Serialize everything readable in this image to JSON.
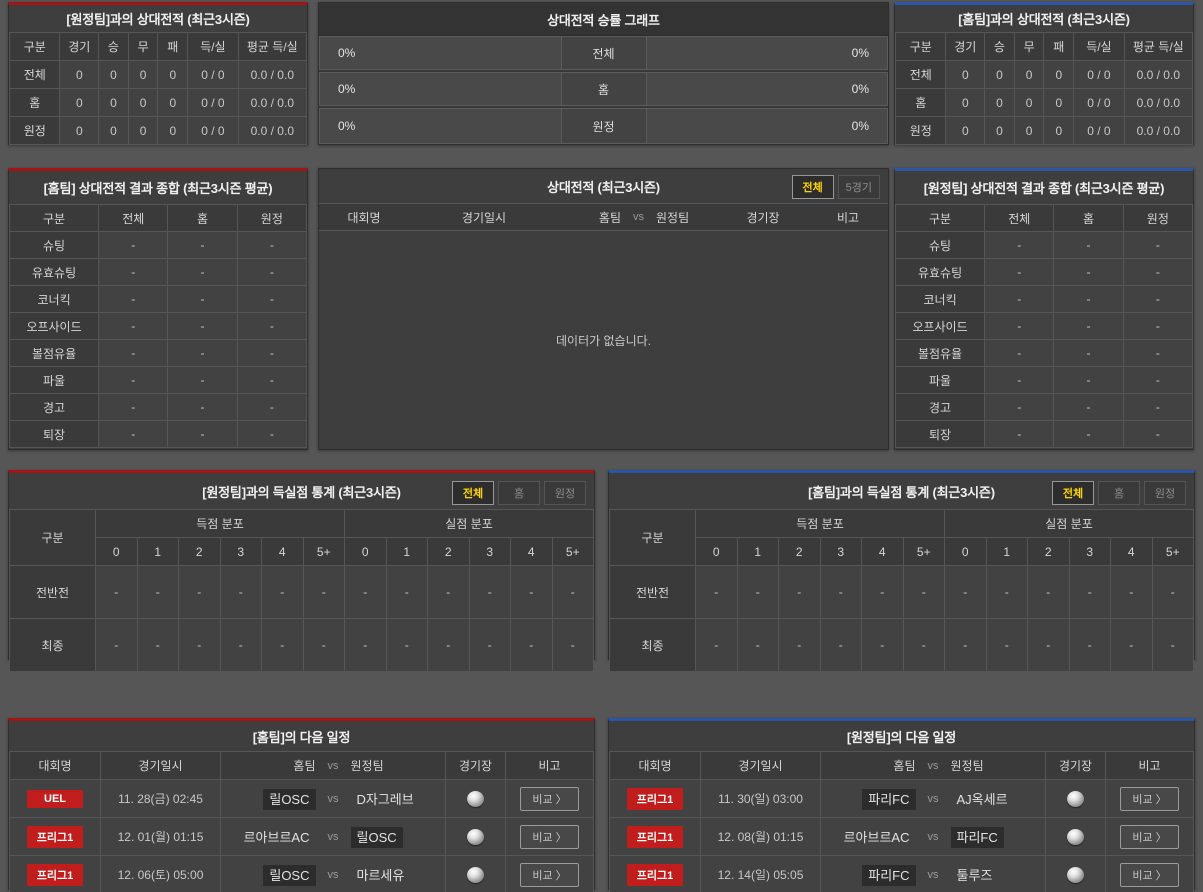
{
  "colors": {
    "accent_red": "#a31515",
    "accent_blue": "#2d55a5",
    "tab_active_text": "#ffd400",
    "league_badge": "#c21d1d"
  },
  "labels": {
    "vs": "vs",
    "compare": "비교 〉",
    "team_header_home": "홈팀",
    "team_header_away": "원정팀",
    "col_league": "대회명",
    "col_datetime": "경기일시",
    "col_stadium": "경기장",
    "col_note": "비고"
  },
  "top_away": {
    "title": "[원정팀]과의 상대전적 (최근3시즌)",
    "headers": [
      "구분",
      "경기",
      "승",
      "무",
      "패",
      "득/실",
      "평균 득/실"
    ],
    "rows": [
      {
        "label": "전체",
        "values": [
          "0",
          "0",
          "0",
          "0",
          "0 / 0",
          "0.0 / 0.0"
        ]
      },
      {
        "label": "홈",
        "values": [
          "0",
          "0",
          "0",
          "0",
          "0 / 0",
          "0.0 / 0.0"
        ]
      },
      {
        "label": "원정",
        "values": [
          "0",
          "0",
          "0",
          "0",
          "0 / 0",
          "0.0 / 0.0"
        ]
      }
    ]
  },
  "winrate": {
    "title": "상대전적 승률 그래프",
    "rows": [
      {
        "left": "0%",
        "label": "전체",
        "right": "0%"
      },
      {
        "left": "0%",
        "label": "홈",
        "right": "0%"
      },
      {
        "left": "0%",
        "label": "원정",
        "right": "0%"
      }
    ]
  },
  "top_home": {
    "title": "[홈팀]과의 상대전적 (최근3시즌)",
    "headers": [
      "구분",
      "경기",
      "승",
      "무",
      "패",
      "득/실",
      "평균 득/실"
    ],
    "rows": [
      {
        "label": "전체",
        "values": [
          "0",
          "0",
          "0",
          "0",
          "0 / 0",
          "0.0 / 0.0"
        ]
      },
      {
        "label": "홈",
        "values": [
          "0",
          "0",
          "0",
          "0",
          "0 / 0",
          "0.0 / 0.0"
        ]
      },
      {
        "label": "원정",
        "values": [
          "0",
          "0",
          "0",
          "0",
          "0 / 0",
          "0.0 / 0.0"
        ]
      }
    ]
  },
  "summary_home": {
    "title": "[홈팀] 상대전적 결과 종합 (최근3시즌 평균)",
    "headers": [
      "구분",
      "전체",
      "홈",
      "원정"
    ],
    "rows": [
      {
        "label": "슈팅",
        "values": [
          "-",
          "-",
          "-"
        ]
      },
      {
        "label": "유효슈팅",
        "values": [
          "-",
          "-",
          "-"
        ]
      },
      {
        "label": "코너킥",
        "values": [
          "-",
          "-",
          "-"
        ]
      },
      {
        "label": "오프사이드",
        "values": [
          "-",
          "-",
          "-"
        ]
      },
      {
        "label": "볼점유율",
        "values": [
          "-",
          "-",
          "-"
        ]
      },
      {
        "label": "파울",
        "values": [
          "-",
          "-",
          "-"
        ]
      },
      {
        "label": "경고",
        "values": [
          "-",
          "-",
          "-"
        ]
      },
      {
        "label": "퇴장",
        "values": [
          "-",
          "-",
          "-"
        ]
      }
    ]
  },
  "h2h_list": {
    "title": "상대전적 (최근3시즌)",
    "tabs": [
      "전체",
      "5경기"
    ],
    "active_tab": "전체",
    "empty": "데이터가 없습니다."
  },
  "summary_away": {
    "title": "[원정팀] 상대전적 결과 종합 (최근3시즌 평균)",
    "headers": [
      "구분",
      "전체",
      "홈",
      "원정"
    ],
    "rows": [
      {
        "label": "슈팅",
        "values": [
          "-",
          "-",
          "-"
        ]
      },
      {
        "label": "유효슈팅",
        "values": [
          "-",
          "-",
          "-"
        ]
      },
      {
        "label": "코너킥",
        "values": [
          "-",
          "-",
          "-"
        ]
      },
      {
        "label": "오프사이드",
        "values": [
          "-",
          "-",
          "-"
        ]
      },
      {
        "label": "볼점유율",
        "values": [
          "-",
          "-",
          "-"
        ]
      },
      {
        "label": "파울",
        "values": [
          "-",
          "-",
          "-"
        ]
      },
      {
        "label": "경고",
        "values": [
          "-",
          "-",
          "-"
        ]
      },
      {
        "label": "퇴장",
        "values": [
          "-",
          "-",
          "-"
        ]
      }
    ]
  },
  "goals_away": {
    "title": "[원정팀]과의 득실점 통계 (최근3시즌)",
    "tabs": [
      "전체",
      "홈",
      "원정"
    ],
    "active_tab": "전체",
    "corner": "구분",
    "group_scored": "득점 분포",
    "group_conceded": "실점 분포",
    "bins": [
      "0",
      "1",
      "2",
      "3",
      "4",
      "5+"
    ],
    "rows": [
      {
        "label": "전반전",
        "values": [
          "-",
          "-",
          "-",
          "-",
          "-",
          "-",
          "-",
          "-",
          "-",
          "-",
          "-",
          "-"
        ]
      },
      {
        "label": "최종",
        "values": [
          "-",
          "-",
          "-",
          "-",
          "-",
          "-",
          "-",
          "-",
          "-",
          "-",
          "-",
          "-"
        ]
      }
    ]
  },
  "goals_home": {
    "title": "[홈팀]과의 득실점 통계 (최근3시즌)",
    "tabs": [
      "전체",
      "홈",
      "원정"
    ],
    "active_tab": "전체",
    "corner": "구분",
    "group_scored": "득점 분포",
    "group_conceded": "실점 분포",
    "bins": [
      "0",
      "1",
      "2",
      "3",
      "4",
      "5+"
    ],
    "rows": [
      {
        "label": "전반전",
        "values": [
          "-",
          "-",
          "-",
          "-",
          "-",
          "-",
          "-",
          "-",
          "-",
          "-",
          "-",
          "-"
        ]
      },
      {
        "label": "최종",
        "values": [
          "-",
          "-",
          "-",
          "-",
          "-",
          "-",
          "-",
          "-",
          "-",
          "-",
          "-",
          "-"
        ]
      }
    ]
  },
  "sched_home": {
    "title": "[홈팀]의 다음 일정",
    "rows": [
      {
        "league": "UEL",
        "datetime": "11. 28(금) 02:45",
        "home": "릴OSC",
        "away": "D자그레브"
      },
      {
        "league": "프리그1",
        "datetime": "12. 01(월) 01:15",
        "home": "르아브르AC",
        "away": "릴OSC"
      },
      {
        "league": "프리그1",
        "datetime": "12. 06(토) 05:00",
        "home": "릴OSC",
        "away": "마르세유"
      }
    ]
  },
  "sched_away": {
    "title": "[원정팀]의 다음 일정",
    "rows": [
      {
        "league": "프리그1",
        "datetime": "11. 30(일) 03:00",
        "home": "파리FC",
        "away": "AJ옥세르"
      },
      {
        "league": "프리그1",
        "datetime": "12. 08(월) 01:15",
        "home": "르아브르AC",
        "away": "파리FC"
      },
      {
        "league": "프리그1",
        "datetime": "12. 14(일) 05:05",
        "home": "파리FC",
        "away": "툴루즈"
      }
    ]
  }
}
